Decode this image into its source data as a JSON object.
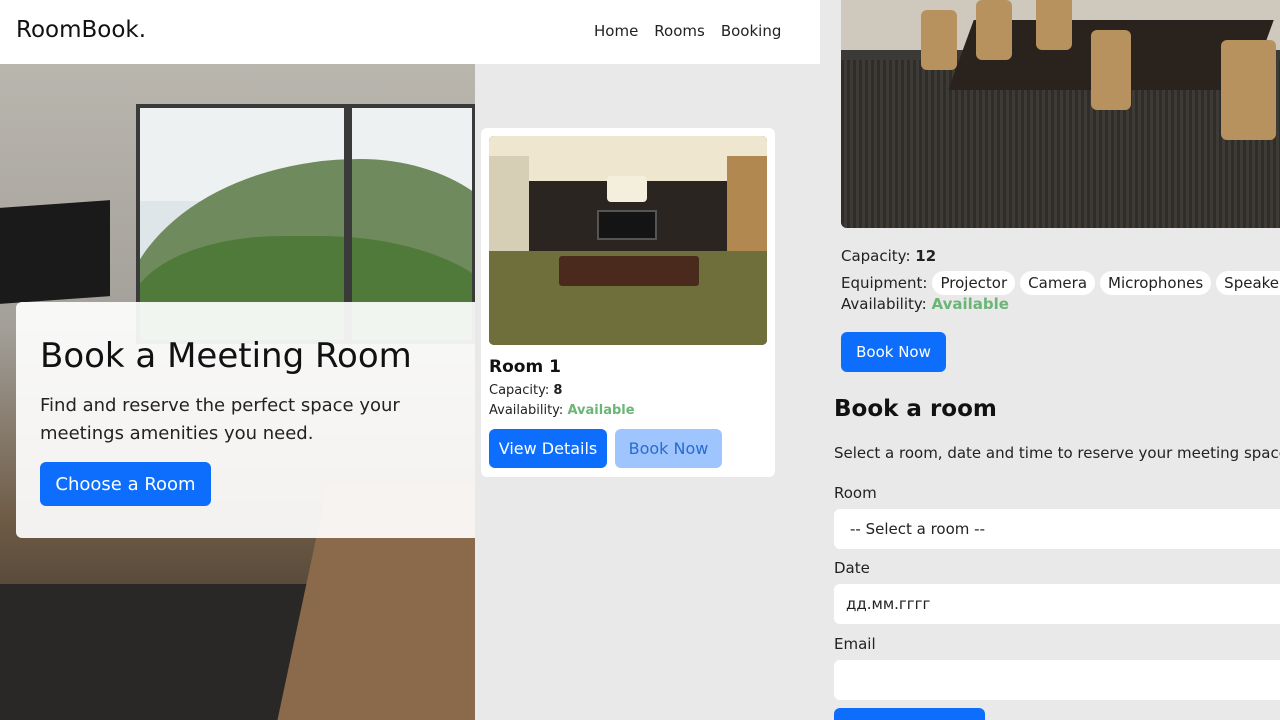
{
  "navbar": {
    "brand": "RoomBook.",
    "links": [
      "Home",
      "Rooms",
      "Booking"
    ]
  },
  "hero": {
    "title": "Book a Meeting Room",
    "text": "Find and reserve the perfect space your meetings amenities you need.",
    "button": "Choose a Room"
  },
  "room_card": {
    "name": "Room 1",
    "capacity_label": "Capacity:",
    "capacity": "8",
    "availability_label": "Availability:",
    "availability": "Available",
    "details_button": "View Details",
    "book_button": "Book Now"
  },
  "room_detail": {
    "capacity_label": "Capacity:",
    "capacity": "12",
    "equipment_label": "Equipment:",
    "equipment": [
      "Projector",
      "Camera",
      "Microphones",
      "Speakers"
    ],
    "availability_label": "Availability:",
    "availability": "Available",
    "book_button": "Book Now"
  },
  "booking_form": {
    "title": "Book a room",
    "subtitle": "Select a room, date and time to reserve your meeting space.",
    "room_label": "Room",
    "room_value": "-- Select a room --",
    "date_label": "Date",
    "date_placeholder": "дд.мм.гггг",
    "email_label": "Email",
    "email_value": ""
  },
  "colors": {
    "primary": "#0d6efd",
    "primary_light": "#9ec5fe",
    "available": "#6bb677",
    "background": "#e9e9e9"
  }
}
